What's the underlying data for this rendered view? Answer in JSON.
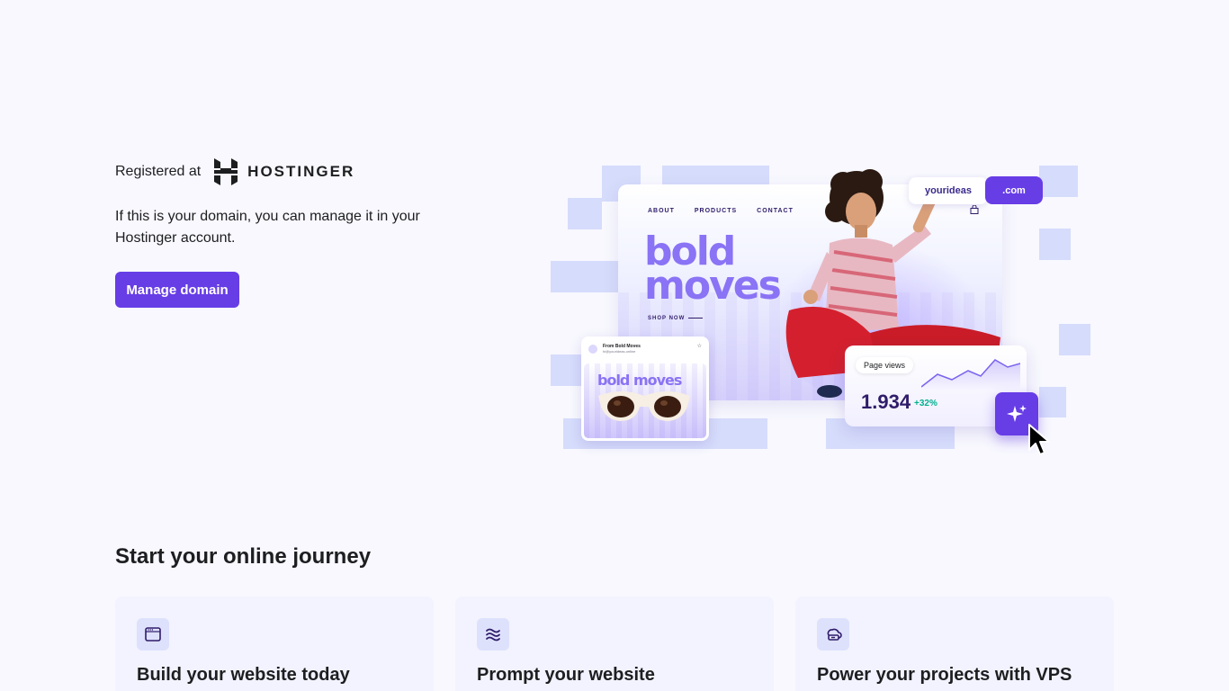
{
  "hero": {
    "registered_label": "Registered at",
    "brand": "HOSTINGER",
    "description": "If this is your domain, you can manage it in your Hostinger account.",
    "manage_button": "Manage domain"
  },
  "illustration": {
    "nav": [
      "ABOUT",
      "PRODUCTS",
      "CONTACT"
    ],
    "headline_line1": "bold",
    "headline_line2": "moves",
    "shop_now": "SHOP NOW",
    "domain_name": "yourideas",
    "tld": ".com",
    "email_from": "From Bold Moves",
    "email_address": "hi@yourideas.online",
    "email_title": "bold moves",
    "stats_label": "Page views",
    "stats_value": "1.934",
    "stats_change": "+32%"
  },
  "journey": {
    "title": "Start your online journey",
    "cards": [
      {
        "title": "Build your website today",
        "icon": "browser-window-icon"
      },
      {
        "title": "Prompt your website",
        "icon": "ai-layers-icon"
      },
      {
        "title": "Power your projects with VPS",
        "icon": "cloud-server-icon"
      }
    ]
  },
  "colors": {
    "brand_purple": "#673de6",
    "background": "#f8f8fe",
    "card_bg": "#f2f3fe",
    "checker": "#d6dcfb",
    "positive": "#00b090"
  }
}
